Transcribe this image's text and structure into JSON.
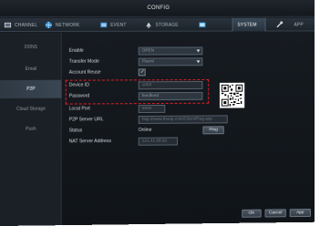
{
  "window": {
    "title": "CONFIG"
  },
  "tabs": [
    {
      "label": "CHANNEL",
      "icon": "channel-icon"
    },
    {
      "label": "NETWORK",
      "icon": "network-icon"
    },
    {
      "label": "EVENT",
      "icon": "event-icon"
    },
    {
      "label": "STORAGE",
      "icon": "storage-icon"
    },
    {
      "label": "SYSTEM",
      "icon": "system-icon"
    },
    {
      "label": "",
      "icon": "tools-icon"
    },
    {
      "label": "APP",
      "icon": "app-icon"
    }
  ],
  "active_tab": "SYSTEM",
  "sidebar": {
    "items": [
      {
        "label": "DDNS"
      },
      {
        "label": "Email"
      },
      {
        "label": "P2P",
        "active": true
      },
      {
        "label": "Cloud Storage"
      },
      {
        "label": "Push"
      }
    ]
  },
  "form": {
    "enable": {
      "label": "Enable",
      "value": "OPEN"
    },
    "transfer_mode": {
      "label": "Transfer Mode",
      "value": "Fluent"
    },
    "account_reuse": {
      "label": "Account Reuse",
      "checked": true
    },
    "device_id": {
      "label": "Device ID",
      "value": "1003"
    },
    "password": {
      "label": "Password",
      "value": "feedfeed"
    },
    "local_port": {
      "label": "Local Port",
      "value": "5800"
    },
    "p2p_server_url": {
      "label": "P2P Server URL",
      "value": "http://www.freeip.com/Client/Reg.asp"
    },
    "status": {
      "label": "Status",
      "value": "Online"
    },
    "ping_button": "Ping",
    "nat_server_address": {
      "label": "NAT Server Address",
      "value": "121.41.58.82"
    }
  },
  "buttons": {
    "ok": "OK",
    "cancel": "Cancel",
    "apply": "App"
  },
  "colors": {
    "highlight": "#e0202a",
    "background": "#141920"
  }
}
